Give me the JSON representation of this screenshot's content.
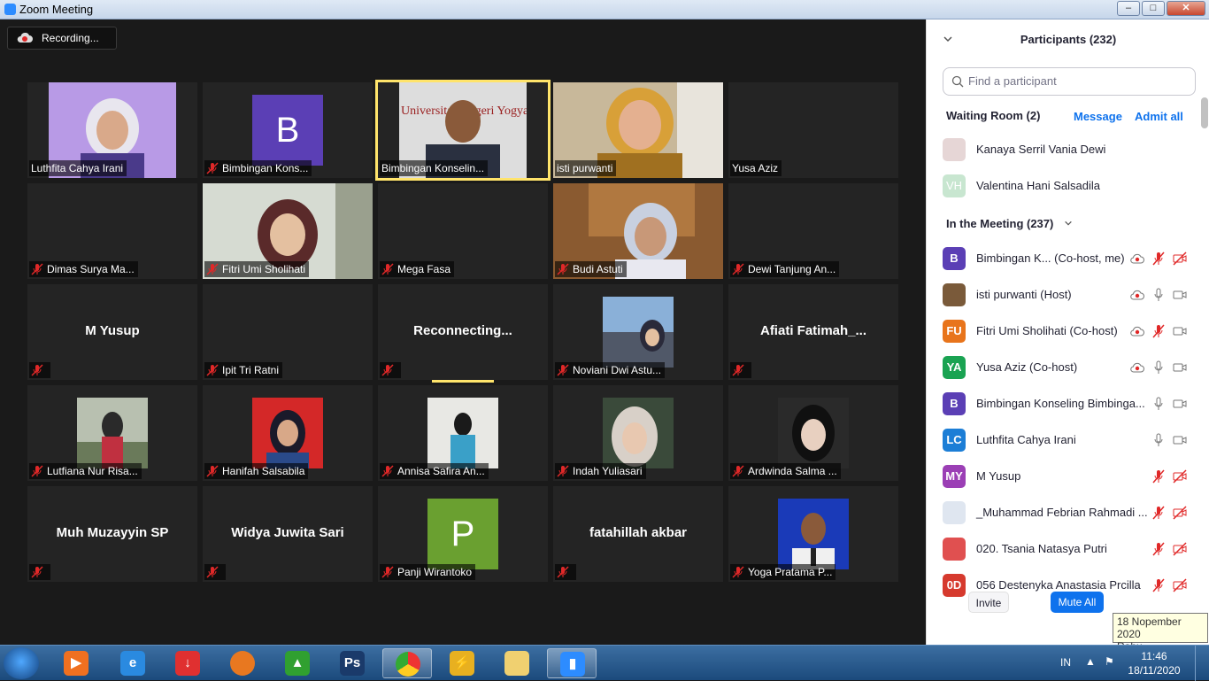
{
  "window": {
    "title": "Zoom Meeting"
  },
  "recording": {
    "label": "Recording..."
  },
  "tiles": {
    "r1c1": "Luthfita Cahya Irani",
    "r1c2": "Bimbingan Kons...",
    "r1c2_letter": "B",
    "r1c3": "Bimbingan Konselin...",
    "r1c4": "isti purwanti",
    "r1c5": "Yusa Aziz",
    "r2c1": "Dimas Surya Ma...",
    "r2c2": "Fitri Umi Sholihati",
    "r2c3": "Mega Fasa",
    "r2c4": "Budi Astuti",
    "r2c5": "Dewi Tanjung An...",
    "r3c1_center": "M Yusup",
    "r3c2": "Ipit Tri Ratni",
    "r3c3_center": "Reconnecting...",
    "r3c4": "Noviani Dwi Astu...",
    "r3c5_center": "Afiati  Fatimah_...",
    "r4c1": "Lutfiana Nur Risa...",
    "r4c2": "Hanifah Salsabila",
    "r4c3": "Annisa Safira An...",
    "r4c4": "Indah Yuliasari",
    "r4c5": "Ardwinda Salma ...",
    "r5c1_center": "Muh Muzayyin SP",
    "r5c2_center": "Widya Juwita Sari",
    "r5c3": "Panji Wirantoko",
    "r5c3_letter": "P",
    "r5c4_center": "fatahillah akbar",
    "r5c5": "Yoga Pratama P..."
  },
  "participants_panel": {
    "header": "Participants (232)",
    "search_placeholder": "Find a participant",
    "waiting_room": "Waiting Room (2)",
    "message": "Message",
    "admit_all": "Admit all",
    "waiting": [
      {
        "name": "Kanaya Serril Vania Dewi"
      },
      {
        "initials": "VH",
        "name": "Valentina Hani Salsadila"
      }
    ],
    "in_meeting": "In the Meeting (237)",
    "members": [
      {
        "initials": "B",
        "name": "Bimbingan K...  (Co-host, me)",
        "color": "#5b3fb5"
      },
      {
        "initials": "",
        "name": "isti purwanti (Host)",
        "color": "#7a5a3a"
      },
      {
        "initials": "FU",
        "name": "Fitri Umi Sholihati (Co-host)",
        "color": "#e8741b"
      },
      {
        "initials": "YA",
        "name": "Yusa Aziz (Co-host)",
        "color": "#1aa352"
      },
      {
        "initials": "B",
        "name": "Bimbingan Konseling Bimbinga...",
        "color": "#5b3fb5"
      },
      {
        "initials": "LC",
        "name": "Luthfita Cahya Irani",
        "color": "#1c7ed6"
      },
      {
        "initials": "MY",
        "name": "M Yusup",
        "color": "#9b3fb5"
      },
      {
        "initials": "",
        "name": "_Muhammad Febrian Rahmadi ...",
        "color": "#dfe6f0"
      },
      {
        "initials": "",
        "name": "020. Tsania Natasya Putri",
        "color": "#e05050"
      },
      {
        "initials": "0D",
        "name": "056 Destenyka Anastasia Prcilla",
        "color": "#d63a2e"
      }
    ],
    "invite": "Invite",
    "mute_all": "Mute All"
  },
  "tooltip": {
    "line1": "18 Nopember 2020",
    "line2": "Rabu"
  },
  "taskbar": {
    "apps": [
      "windows-media-player",
      "internet-explorer",
      "download-manager",
      "firefox",
      "corel",
      "photoshop",
      "chrome",
      "winamp",
      "file-explorer",
      "zoom"
    ],
    "photoshop_label": "Ps",
    "lang": "IN",
    "time": "11:46",
    "date": "18/11/2020"
  },
  "colors": {
    "zoom_blue": "#0e72ed",
    "active_speaker": "#ffe46b",
    "mute_red": "#e02828"
  }
}
